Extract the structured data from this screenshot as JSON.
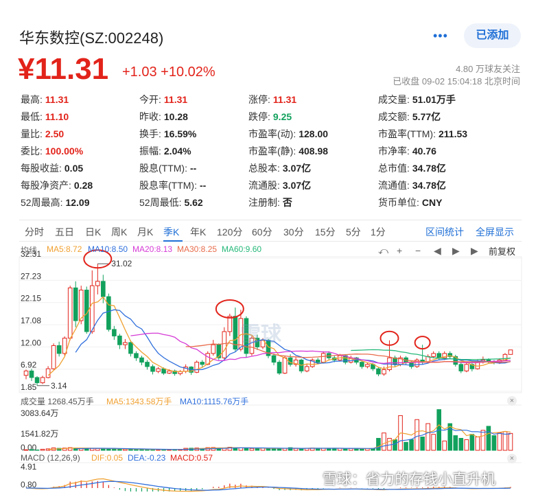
{
  "header": {
    "title": "华东数控(SZ:002248)",
    "share_icon": "share-icon",
    "add_label": "已添加",
    "price": "¥11.31",
    "change": "+1.03 +10.02%",
    "fans": "4.80 万球友关注",
    "closed_time": "已收盘 09-02 15:04:18 北京时间"
  },
  "quote": [
    [
      "最高:",
      "11.31",
      "red"
    ],
    [
      "今开:",
      "11.31",
      "red"
    ],
    [
      "涨停:",
      "11.31",
      "red"
    ],
    [
      "成交量:",
      "51.01万手",
      "dark"
    ],
    [
      "最低:",
      "11.10",
      "red"
    ],
    [
      "昨收:",
      "10.28",
      "dark"
    ],
    [
      "跌停:",
      "9.25",
      "green"
    ],
    [
      "成交额:",
      "5.77亿",
      "dark"
    ],
    [
      "量比:",
      "2.50",
      "red"
    ],
    [
      "换手:",
      "16.59%",
      "dark"
    ],
    [
      "市盈率(动):",
      "128.00",
      "dark"
    ],
    [
      "市盈率(TTM):",
      "211.53",
      "dark"
    ],
    [
      "委比:",
      "100.00%",
      "red"
    ],
    [
      "振幅:",
      "2.04%",
      "dark"
    ],
    [
      "市盈率(静):",
      "408.98",
      "dark"
    ],
    [
      "市净率:",
      "40.76",
      "dark"
    ],
    [
      "每股收益:",
      "0.05",
      "dark"
    ],
    [
      "股息(TTM):",
      "--",
      "dark"
    ],
    [
      "总股本:",
      "3.07亿",
      "dark"
    ],
    [
      "总市值:",
      "34.78亿",
      "dark"
    ],
    [
      "每股净资产:",
      "0.28",
      "dark"
    ],
    [
      "股息率(TTM):",
      "--",
      "dark"
    ],
    [
      "流通股:",
      "3.07亿",
      "dark"
    ],
    [
      "流通值:",
      "34.78亿",
      "dark"
    ],
    [
      "52周最高:",
      "12.09",
      "dark"
    ],
    [
      "52周最低:",
      "5.62",
      "dark"
    ],
    [
      "注册制:",
      "否",
      "dark"
    ],
    [
      "货币单位:",
      "CNY",
      "dark"
    ]
  ],
  "tabs": [
    "分时",
    "五日",
    "日K",
    "周K",
    "月K",
    "季K",
    "年K",
    "120分",
    "60分",
    "30分",
    "15分",
    "5分",
    "1分"
  ],
  "active_tab": "季K",
  "right_links": [
    "区间统计",
    "全屏显示"
  ],
  "toolbar": {
    "icons": [
      "undo-icon",
      "zoom-in-icon",
      "zoom-out-icon",
      "pan-left-icon",
      "play-icon",
      "pan-right-icon"
    ],
    "adjust": "前复权"
  },
  "ma_legend": [
    {
      "label": "均线",
      "color": "#666666"
    },
    {
      "label": "MA5:8.72",
      "color": "#f0a030"
    },
    {
      "label": "MA10:8.50",
      "color": "#2f6fdc"
    },
    {
      "label": "MA20:8.13",
      "color": "#d63ad6"
    },
    {
      "label": "MA30:8.25",
      "color": "#e86b4a"
    },
    {
      "label": "MA60:9.60",
      "color": "#25b879"
    }
  ],
  "vol_legend": [
    {
      "label": "成交量 1268.45万手",
      "color": "#555555"
    },
    {
      "label": "MA5:1343.58万手",
      "color": "#f0a030"
    },
    {
      "label": "MA10:1115.76万手",
      "color": "#2f6fdc"
    }
  ],
  "macd_legend": [
    {
      "label": "MACD (12,26,9)",
      "color": "#555555"
    },
    {
      "label": "DIF:0.05",
      "color": "#f0a030"
    },
    {
      "label": "DEA:-0.23",
      "color": "#2f6fdc"
    },
    {
      "label": "MACD:0.57",
      "color": "#e2231a"
    }
  ],
  "watermark_logo": "雪球",
  "watermark": "雪球：省力的存钱小直升机",
  "chart_data": {
    "type": "candlestick",
    "price_axis": {
      "ticks": [
        "32.31",
        "27.23",
        "22.15",
        "17.08",
        "12.00",
        "6.92",
        "1.85"
      ],
      "ylim": [
        1.85,
        32.31
      ]
    },
    "annotations": {
      "max_label": "31.02",
      "min_label": "3.14"
    },
    "candles": [
      [
        5.5,
        6.5,
        4.6,
        6.8
      ],
      [
        6.5,
        5.0,
        4.2,
        7.0
      ],
      [
        5.0,
        3.8,
        3.14,
        5.3
      ],
      [
        3.8,
        5.0,
        3.5,
        5.4
      ],
      [
        5.0,
        7.0,
        4.8,
        7.6
      ],
      [
        7.0,
        12.3,
        6.8,
        12.8
      ],
      [
        12.3,
        10.5,
        9.8,
        13.2
      ],
      [
        10.5,
        14.0,
        10.0,
        14.4
      ],
      [
        14.0,
        25.5,
        13.5,
        26.0
      ],
      [
        25.5,
        18.0,
        16.5,
        27.0
      ],
      [
        18.0,
        25.0,
        17.2,
        26.0
      ],
      [
        25.0,
        15.5,
        15.0,
        25.8
      ],
      [
        15.5,
        26.0,
        15.0,
        29.5
      ],
      [
        26.0,
        27.0,
        24.0,
        31.02
      ],
      [
        27.0,
        23.5,
        22.0,
        28.5
      ],
      [
        23.5,
        16.0,
        15.5,
        24.2
      ],
      [
        16.0,
        14.5,
        13.6,
        16.8
      ],
      [
        14.5,
        12.5,
        11.5,
        15.0
      ],
      [
        12.5,
        13.0,
        11.5,
        13.8
      ],
      [
        13.0,
        10.5,
        9.8,
        13.5
      ],
      [
        10.5,
        9.5,
        8.8,
        11.0
      ],
      [
        9.5,
        8.5,
        7.8,
        10.0
      ],
      [
        8.5,
        7.5,
        6.8,
        9.0
      ],
      [
        7.5,
        6.4,
        5.7,
        8.0
      ],
      [
        6.4,
        7.0,
        6.0,
        7.4
      ],
      [
        7.0,
        6.0,
        5.6,
        7.3
      ],
      [
        6.0,
        6.5,
        5.8,
        6.9
      ],
      [
        6.5,
        5.9,
        5.4,
        6.8
      ],
      [
        5.9,
        6.4,
        5.5,
        6.7
      ],
      [
        6.4,
        7.4,
        6.0,
        8.0
      ],
      [
        7.4,
        6.2,
        5.6,
        7.6
      ],
      [
        6.2,
        8.5,
        6.0,
        8.9
      ],
      [
        8.5,
        8.0,
        7.4,
        9.0
      ],
      [
        8.0,
        10.5,
        7.8,
        11.0
      ],
      [
        10.5,
        12.5,
        10.0,
        13.6
      ],
      [
        12.5,
        9.5,
        9.0,
        12.8
      ],
      [
        9.5,
        15.5,
        9.2,
        16.5
      ],
      [
        15.5,
        19.0,
        14.5,
        19.6
      ],
      [
        19.0,
        11.5,
        11.0,
        21.0
      ],
      [
        11.5,
        18.5,
        11.0,
        20.5
      ],
      [
        18.5,
        10.5,
        9.5,
        19.0
      ],
      [
        10.5,
        14.0,
        10.0,
        14.5
      ],
      [
        14.0,
        12.0,
        11.3,
        14.8
      ],
      [
        12.0,
        13.5,
        11.5,
        14.0
      ],
      [
        13.5,
        10.0,
        9.4,
        13.8
      ],
      [
        10.0,
        8.5,
        7.8,
        10.5
      ],
      [
        8.5,
        6.0,
        5.6,
        9.0
      ],
      [
        6.0,
        9.5,
        5.8,
        10.0
      ],
      [
        9.5,
        8.0,
        7.5,
        10.3
      ],
      [
        8.0,
        9.0,
        7.5,
        9.6
      ],
      [
        9.0,
        6.5,
        6.0,
        9.3
      ],
      [
        6.5,
        7.5,
        6.2,
        8.0
      ],
      [
        7.5,
        9.0,
        7.2,
        9.4
      ],
      [
        9.0,
        8.5,
        8.0,
        9.5
      ],
      [
        8.5,
        10.5,
        8.2,
        11.0
      ],
      [
        10.5,
        9.5,
        9.0,
        11.0
      ],
      [
        9.5,
        9.0,
        8.5,
        10.0
      ],
      [
        9.0,
        10.0,
        8.7,
        10.4
      ],
      [
        10.0,
        8.5,
        8.0,
        10.3
      ],
      [
        8.5,
        9.5,
        8.2,
        10.0
      ],
      [
        9.5,
        8.5,
        8.0,
        9.7
      ],
      [
        8.5,
        7.5,
        7.0,
        8.9
      ],
      [
        7.5,
        8.0,
        7.1,
        8.4
      ],
      [
        8.0,
        7.0,
        6.5,
        8.3
      ],
      [
        7.0,
        5.8,
        5.3,
        7.4
      ],
      [
        5.8,
        6.8,
        5.4,
        7.5
      ],
      [
        6.8,
        9.5,
        6.4,
        13.5
      ],
      [
        9.5,
        8.0,
        7.4,
        10.0
      ],
      [
        8.0,
        9.5,
        7.6,
        10.0
      ],
      [
        9.5,
        8.5,
        8.0,
        9.9
      ],
      [
        8.5,
        7.5,
        7.0,
        8.9
      ],
      [
        7.5,
        9.0,
        7.2,
        9.4
      ],
      [
        9.0,
        8.5,
        8.0,
        12.5
      ],
      [
        8.5,
        9.8,
        8.2,
        10.3
      ],
      [
        9.8,
        10.5,
        9.4,
        11.0
      ],
      [
        10.5,
        9.5,
        9.0,
        11.0
      ],
      [
        9.5,
        10.5,
        9.0,
        11.0
      ],
      [
        10.5,
        9.8,
        9.2,
        11.0
      ],
      [
        9.8,
        8.0,
        7.5,
        10.2
      ],
      [
        8.0,
        6.5,
        6.0,
        8.5
      ],
      [
        6.5,
        8.0,
        6.2,
        8.5
      ],
      [
        8.0,
        7.0,
        6.4,
        8.5
      ],
      [
        7.0,
        8.5,
        6.8,
        9.0
      ],
      [
        8.5,
        9.0,
        8.2,
        9.8
      ],
      [
        9.0,
        8.6,
        8.2,
        9.4
      ],
      [
        8.6,
        8.4,
        8.0,
        9.0
      ],
      [
        8.4,
        9.0,
        8.1,
        9.4
      ],
      [
        9.0,
        10.28,
        8.9,
        10.6
      ],
      [
        10.28,
        11.31,
        10.2,
        11.31
      ]
    ],
    "volume_axis": {
      "ticks": [
        "3083.64万",
        "1541.82万",
        "0.00"
      ],
      "ylim": [
        0,
        3083.64
      ]
    },
    "volume": [
      40,
      60,
      30,
      80,
      110,
      180,
      150,
      170,
      200,
      170,
      160,
      140,
      140,
      130,
      120,
      130,
      110,
      100,
      90,
      90,
      70,
      80,
      60,
      55,
      60,
      55,
      60,
      65,
      70,
      150,
      160,
      170,
      140,
      200,
      210,
      170,
      180,
      230,
      200,
      180,
      160,
      140,
      150,
      160,
      150,
      140,
      130,
      150,
      200,
      140,
      130,
      150,
      170,
      160,
      150,
      140,
      160,
      150,
      140,
      130,
      120,
      110,
      130,
      140,
      900,
      1300,
      900,
      800,
      2600,
      600,
      800,
      2300,
      1000,
      2000,
      1200,
      3050,
      700,
      2000,
      1100,
      900,
      800,
      1200,
      1000,
      1500,
      1800,
      1100,
      1300,
      1400,
      1268.45
    ],
    "macd_axis": {
      "ticks": [
        "4.91",
        "0.80"
      ],
      "ylim": [
        -0.8,
        4.91
      ]
    }
  }
}
